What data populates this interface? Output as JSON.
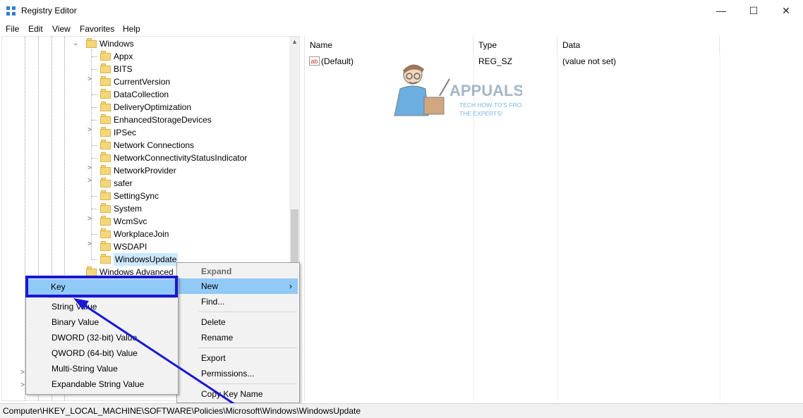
{
  "window": {
    "title": "Registry Editor",
    "minimize_icon": "minimize-icon",
    "maximize_icon": "maximize-icon",
    "close_icon": "close-icon",
    "minimize_glyph": "—",
    "maximize_glyph": "☐",
    "close_glyph": "✕"
  },
  "menu": [
    "File",
    "Edit",
    "View",
    "Favorites",
    "Help"
  ],
  "tree": {
    "parent": "Windows",
    "children": [
      "Appx",
      "BITS",
      "CurrentVersion",
      "DataCollection",
      "DeliveryOptimization",
      "EnhancedStorageDevices",
      "IPSec",
      "Network Connections",
      "NetworkConnectivityStatusIndicator",
      "NetworkProvider",
      "safer",
      "SettingSync",
      "System",
      "WcmSvc",
      "WorkplaceJoin",
      "WSDAPI",
      "WindowsUpdate"
    ],
    "sibling": "Windows Advanced",
    "selected": "WindowsUpdate"
  },
  "list": {
    "headers": [
      "Name",
      "Type",
      "Data"
    ],
    "rows": [
      {
        "name": "(Default)",
        "type": "REG_SZ",
        "data": "(value not set)"
      }
    ]
  },
  "context_menu": {
    "items": [
      "Expand",
      "New",
      "Find...",
      "Delete",
      "Rename",
      "Export",
      "Permissions...",
      "Copy Key Name"
    ],
    "highlighted": "New"
  },
  "submenu": {
    "items": [
      "Key",
      "String Value",
      "Binary Value",
      "DWORD (32-bit) Value",
      "QWORD (64-bit) Value",
      "Multi-String Value",
      "Expandable String Value"
    ],
    "highlighted": "Key"
  },
  "status": {
    "path": "Computer\\HKEY_LOCAL_MACHINE\\SOFTWARE\\Policies\\Microsoft\\Windows\\WindowsUpdate"
  },
  "watermark": {
    "brand": "APPUALS",
    "tagline1": "TECH HOW-TO'S FROM",
    "tagline2": "THE EXPERTS!"
  },
  "colors": {
    "highlight": "#91c9f7",
    "annotation": "#1a16d6",
    "selected_node": "#cce8ff"
  }
}
